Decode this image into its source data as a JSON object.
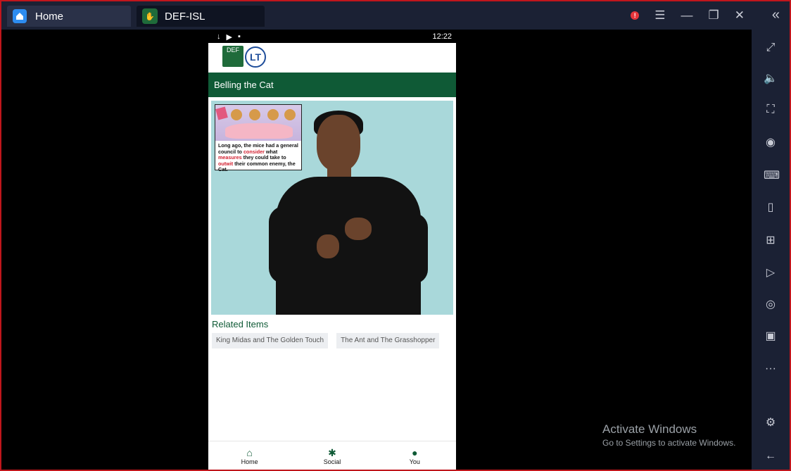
{
  "titlebar": {
    "tabs": [
      {
        "label": "Home",
        "icon": "home-icon"
      },
      {
        "label": "DEF-ISL",
        "icon": "def-app-icon"
      }
    ],
    "controls": [
      "alert-icon",
      "menu-icon",
      "minimize-icon",
      "restore-icon",
      "close-icon"
    ],
    "alert_badge": "!",
    "collapse_glyph": "«"
  },
  "sidebar": {
    "buttons": [
      {
        "name": "fullscreen-icon",
        "glyph": "⤢"
      },
      {
        "name": "volume-icon",
        "glyph": "🔈"
      },
      {
        "name": "screen-select-icon",
        "glyph": "⛶"
      },
      {
        "name": "eye-icon",
        "glyph": "◉"
      },
      {
        "name": "keyboard-icon",
        "glyph": "⌨"
      },
      {
        "name": "phone-icon",
        "glyph": "▯"
      },
      {
        "name": "gamepad-icon",
        "glyph": "⊞"
      },
      {
        "name": "media-icon",
        "glyph": "▷"
      },
      {
        "name": "camera-icon",
        "glyph": "◎"
      },
      {
        "name": "record-icon",
        "glyph": "▣"
      },
      {
        "name": "more-icon",
        "glyph": "···"
      },
      {
        "name": "settings-icon",
        "glyph": "⚙"
      },
      {
        "name": "back-icon",
        "glyph": "←"
      }
    ]
  },
  "phone": {
    "status": {
      "time": "12:22",
      "icons": [
        "↓",
        "▶",
        "▪"
      ]
    },
    "logo_def": "DEF",
    "logo_lt": "LT",
    "story_title": "Belling the Cat",
    "story_text": {
      "p1": "Long ago, the mice had a general council to ",
      "w1": "consider",
      "p2": " what ",
      "w2": "measures",
      "p3": " they could take to ",
      "w3": "outwit",
      "p4": " their common enemy, the Cat."
    },
    "related_title": "Related Items",
    "related_items": [
      "King Midas and The Golden Touch",
      "The Ant and The Grasshopper"
    ],
    "nav": [
      {
        "label": "Home",
        "glyph": "⌂"
      },
      {
        "label": "Social",
        "glyph": "✱"
      },
      {
        "label": "You",
        "glyph": "●"
      }
    ]
  },
  "watermark": {
    "line1": "Activate Windows",
    "line2": "Go to Settings to activate Windows."
  },
  "colors": {
    "brand_green": "#0f5a36",
    "frame_red": "#c0161c",
    "chrome": "#1b2134"
  }
}
